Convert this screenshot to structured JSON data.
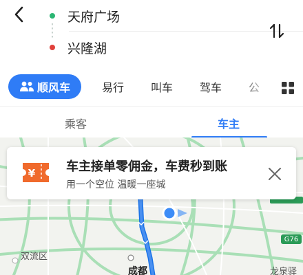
{
  "route": {
    "start": "天府广场",
    "end": "兴隆湖",
    "start_color": "#2bb673",
    "end_color": "#e0403a"
  },
  "modes": {
    "active": "顺风车",
    "items": [
      "易行",
      "叫车",
      "驾车",
      "公"
    ]
  },
  "roles": {
    "passenger": "乘客",
    "driver": "车主",
    "active": "车主"
  },
  "promo": {
    "title": "车主接单零佣金，车费秒到账",
    "subtitle": "用一个空位 温暖一座城",
    "icon": "ticket-yuan-icon"
  },
  "map": {
    "labels": {
      "shuangliu": "双流区",
      "chengdu": "成都",
      "longquan": "龙泉驿",
      "g76": "G76"
    }
  },
  "colors": {
    "accent": "#2f7cf6",
    "promo_icon": "#f06a2c",
    "road_green": "#a9dfb6",
    "route_blue": "#1a73e8"
  }
}
